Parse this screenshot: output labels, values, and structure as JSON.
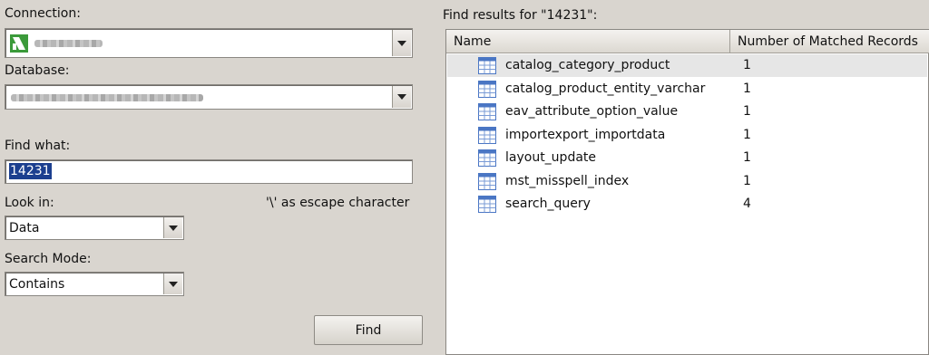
{
  "left": {
    "connection_label": "Connection:",
    "database_label": "Database:",
    "find_what_label": "Find what:",
    "find_what_value": "14231",
    "look_in_label": "Look in:",
    "escape_note": "'\\' as escape character",
    "look_in_value": "Data",
    "search_mode_label": "Search Mode:",
    "search_mode_value": "Contains",
    "find_button": "Find"
  },
  "results": {
    "title": "Find results for \"14231\":",
    "columns": [
      "Name",
      "Number of Matched Records"
    ],
    "rows": [
      {
        "name": "catalog_category_product",
        "count": "1"
      },
      {
        "name": "catalog_product_entity_varchar",
        "count": "1"
      },
      {
        "name": "eav_attribute_option_value",
        "count": "1"
      },
      {
        "name": "importexport_importdata",
        "count": "1"
      },
      {
        "name": "layout_update",
        "count": "1"
      },
      {
        "name": "mst_misspell_index",
        "count": "1"
      },
      {
        "name": "search_query",
        "count": "4"
      }
    ]
  },
  "icons": {
    "connection": "mysql-connection-icon",
    "table": "table-icon",
    "dropdown": "chevron-down-icon"
  },
  "colors": {
    "background": "#d9d5cf",
    "selection": "#1c3f8f",
    "selected_row": "#e6e6e6",
    "table_icon_blue": "#4a76c4"
  }
}
